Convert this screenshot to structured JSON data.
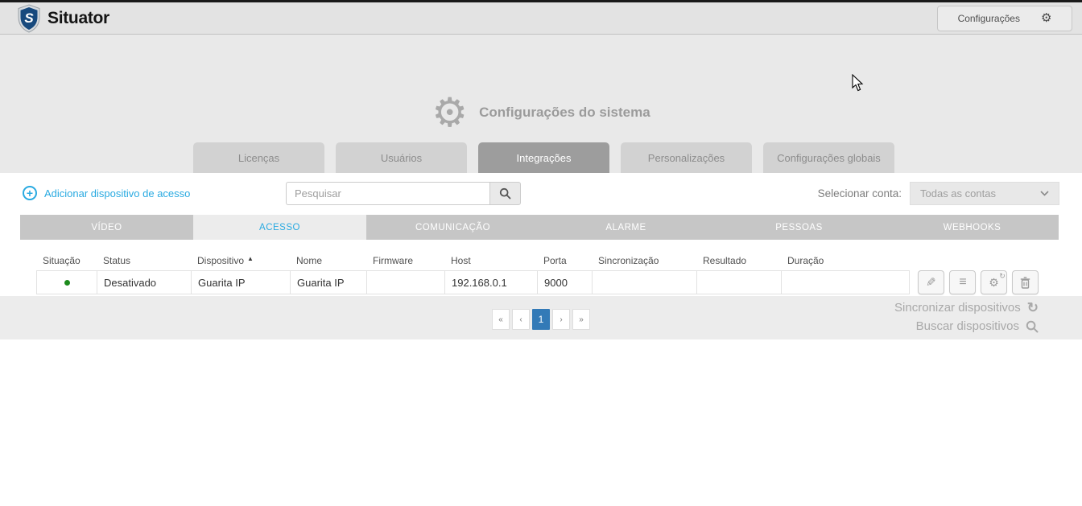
{
  "colors": {
    "accent": "#29aae1",
    "pagination_active": "#337ab7",
    "status_dot_ok": "#1c8a1c"
  },
  "header": {
    "app_name": "Situator",
    "logo_letter": "S",
    "settings_button_label": "Configurações"
  },
  "hero": {
    "title": "Configurações do sistema"
  },
  "main_tabs": [
    {
      "label": "Licenças",
      "active": false
    },
    {
      "label": "Usuários",
      "active": false
    },
    {
      "label": "Integrações",
      "active": true
    },
    {
      "label": "Personalizações",
      "active": false
    },
    {
      "label": "Configurações globais",
      "active": false
    }
  ],
  "toolbar": {
    "add_device_label": "Adicionar dispositivo de acesso",
    "search_placeholder": "Pesquisar",
    "account_select_label": "Selecionar conta:",
    "account_select_value": "Todas as contas"
  },
  "sub_tabs": [
    {
      "label": "VÍDEO",
      "active": false
    },
    {
      "label": "ACESSO",
      "active": true
    },
    {
      "label": "COMUNICAÇÃO",
      "active": false
    },
    {
      "label": "ALARME",
      "active": false
    },
    {
      "label": "PESSOAS",
      "active": false
    },
    {
      "label": "WEBHOOKS",
      "active": false
    }
  ],
  "table": {
    "columns": [
      "Situação",
      "Status",
      "Dispositivo",
      "Nome",
      "Firmware",
      "Host",
      "Porta",
      "Sincronização",
      "Resultado",
      "Duração"
    ],
    "sorted_column": "Dispositivo",
    "sort_direction": "asc",
    "rows": [
      {
        "situacao": "ok",
        "status": "Desativado",
        "dispositivo": "Guarita IP",
        "nome": "Guarita IP",
        "firmware": "",
        "host": "192.168.0.1",
        "porta": "9000",
        "sincronizacao": "",
        "resultado": "",
        "duracao": ""
      }
    ]
  },
  "pagination": {
    "labels": [
      "«",
      "‹",
      "1",
      "›",
      "»"
    ],
    "current_page": "1"
  },
  "footer": {
    "sync_devices_label": "Sincronizar dispositivos",
    "search_devices_label": "Buscar dispositivos"
  },
  "icons": {
    "gear": "⚙",
    "plus": "+",
    "sort_asc": "▲",
    "pencil": "✎",
    "list": "≡",
    "refresh": "↻"
  }
}
